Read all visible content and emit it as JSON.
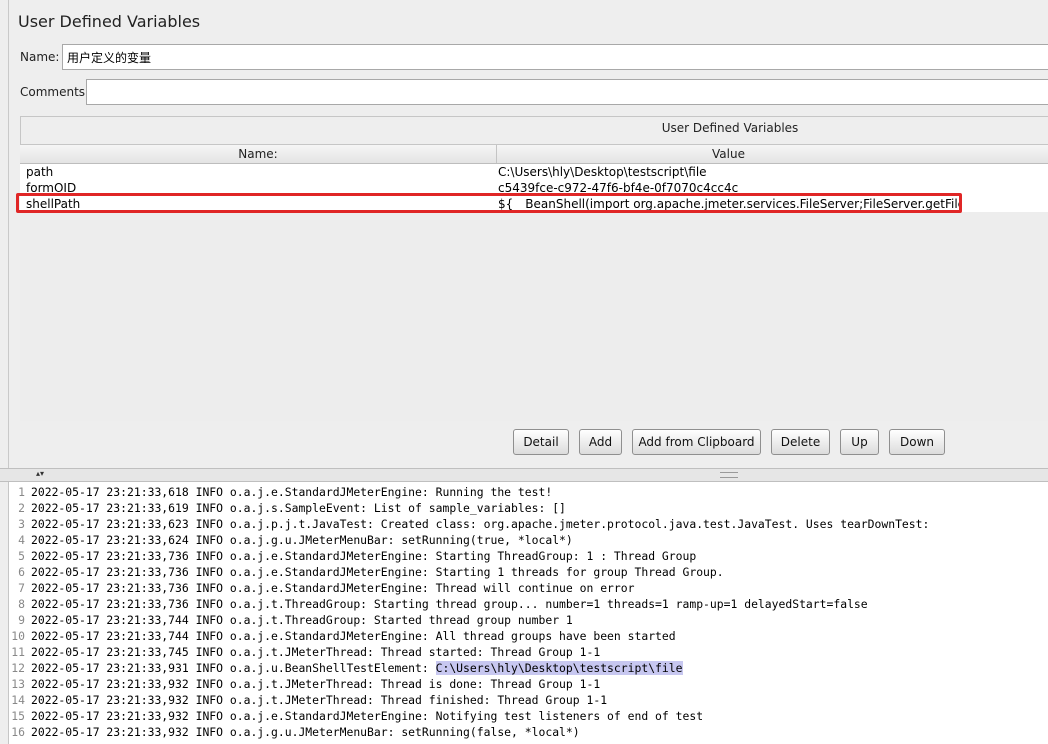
{
  "panel": {
    "title": "User Defined Variables",
    "name_label": "Name:",
    "name_value": "用户定义的变量",
    "comments_label": "Comments:",
    "comments_value": ""
  },
  "table": {
    "caption": "User Defined Variables",
    "columns": [
      "Name:",
      "Value"
    ],
    "rows": [
      {
        "name": "path",
        "value": "C:\\Users\\hly\\Desktop\\testscript\\file"
      },
      {
        "name": "formOID",
        "value": "c5439fce-c972-47f6-bf4e-0f7070c4cc4c"
      },
      {
        "name": "shellPath",
        "value": "${__BeanShell(import org.apache.jmeter.services.FileServer;FileServer.getFileServ..."
      }
    ],
    "highlight_color": "#e02626"
  },
  "buttons": {
    "detail": "Detail",
    "add": "Add",
    "add_clipboard": "Add from Clipboard",
    "delete": "Delete",
    "up": "Up",
    "down": "Down"
  },
  "splitter": {
    "arrows": "▴▾"
  },
  "log": {
    "lines": [
      {
        "n": "1",
        "text": "2022-05-17 23:21:33,618 INFO o.a.j.e.StandardJMeterEngine: Running the test!"
      },
      {
        "n": "2",
        "text": "2022-05-17 23:21:33,619 INFO o.a.j.s.SampleEvent: List of sample_variables: []"
      },
      {
        "n": "3",
        "text": "2022-05-17 23:21:33,623 INFO o.a.j.p.j.t.JavaTest: Created class: org.apache.jmeter.protocol.java.test.JavaTest. Uses tearDownTest:"
      },
      {
        "n": "4",
        "text": "2022-05-17 23:21:33,624 INFO o.a.j.g.u.JMeterMenuBar: setRunning(true, *local*)"
      },
      {
        "n": "5",
        "text": "2022-05-17 23:21:33,736 INFO o.a.j.e.StandardJMeterEngine: Starting ThreadGroup: 1 : Thread Group"
      },
      {
        "n": "6",
        "text": "2022-05-17 23:21:33,736 INFO o.a.j.e.StandardJMeterEngine: Starting 1 threads for group Thread Group."
      },
      {
        "n": "7",
        "text": "2022-05-17 23:21:33,736 INFO o.a.j.e.StandardJMeterEngine: Thread will continue on error"
      },
      {
        "n": "8",
        "text": "2022-05-17 23:21:33,736 INFO o.a.j.t.ThreadGroup: Starting thread group... number=1 threads=1 ramp-up=1 delayedStart=false"
      },
      {
        "n": "9",
        "text": "2022-05-17 23:21:33,744 INFO o.a.j.t.ThreadGroup: Started thread group number 1"
      },
      {
        "n": "10",
        "text": "2022-05-17 23:21:33,744 INFO o.a.j.e.StandardJMeterEngine: All thread groups have been started"
      },
      {
        "n": "11",
        "text": "2022-05-17 23:21:33,745 INFO o.a.j.t.JMeterThread: Thread started: Thread Group 1-1"
      },
      {
        "n": "12",
        "text": "2022-05-17 23:21:33,931 INFO o.a.j.u.BeanShellTestElement: ",
        "selected": "C:\\Users\\hly\\Desktop\\testscript\\file"
      },
      {
        "n": "13",
        "text": "2022-05-17 23:21:33,932 INFO o.a.j.t.JMeterThread: Thread is done: Thread Group 1-1"
      },
      {
        "n": "14",
        "text": "2022-05-17 23:21:33,932 INFO o.a.j.t.JMeterThread: Thread finished: Thread Group 1-1"
      },
      {
        "n": "15",
        "text": "2022-05-17 23:21:33,932 INFO o.a.j.e.StandardJMeterEngine: Notifying test listeners of end of test"
      },
      {
        "n": "16",
        "text": "2022-05-17 23:21:33,932 INFO o.a.j.g.u.JMeterMenuBar: setRunning(false, *local*)"
      }
    ],
    "selection_color": "#c7c7f0"
  }
}
